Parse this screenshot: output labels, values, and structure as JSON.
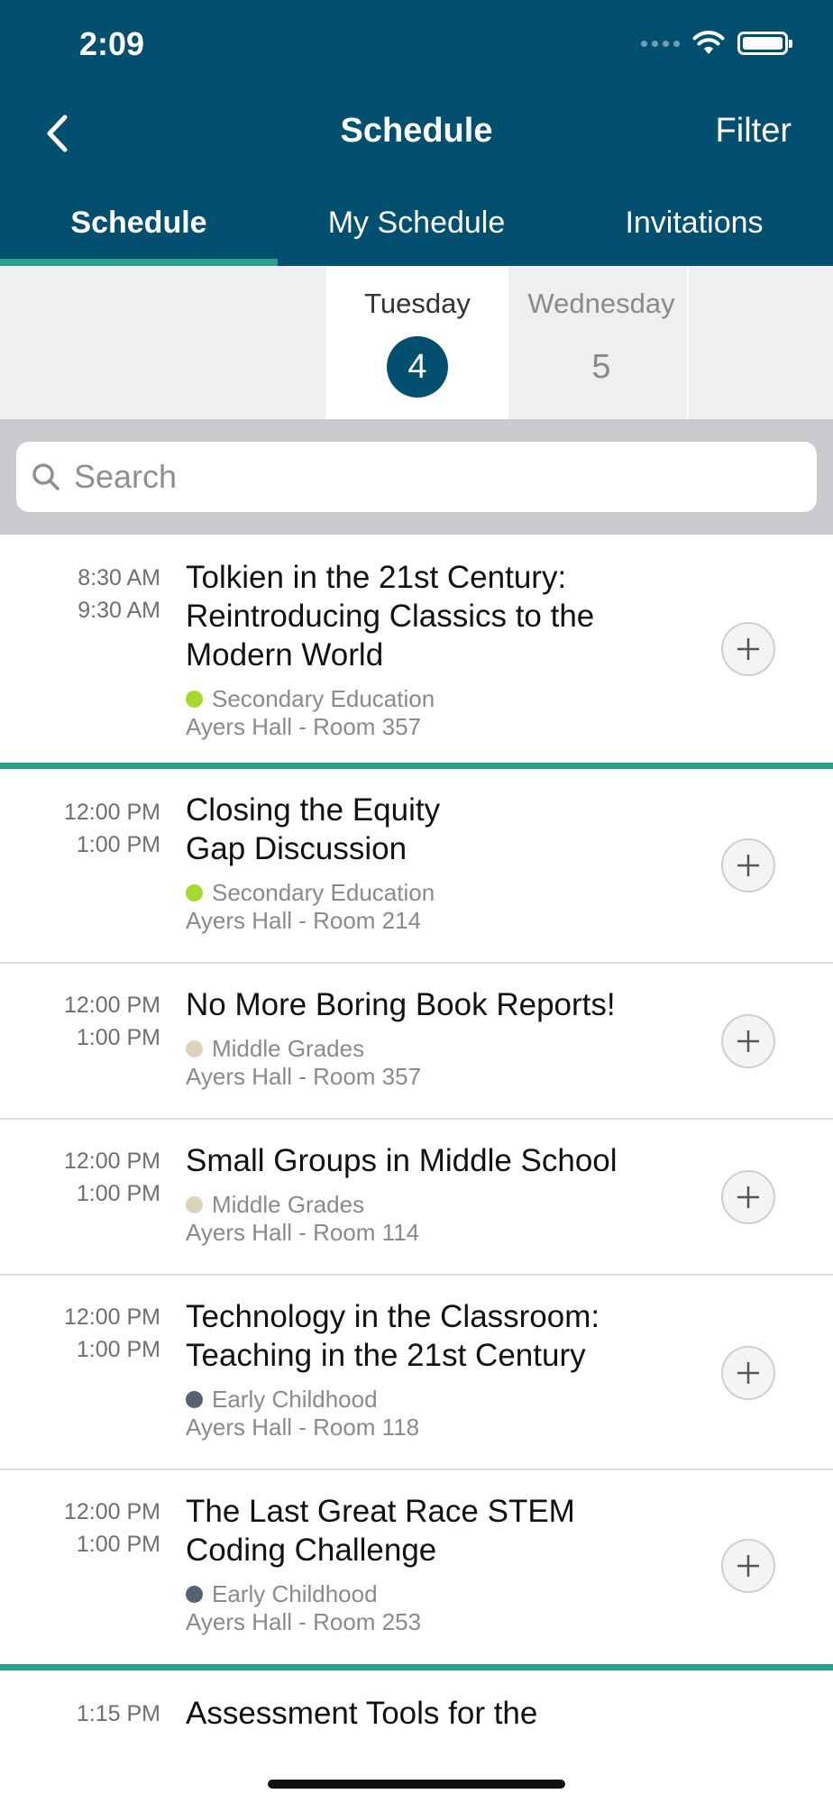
{
  "status_bar": {
    "time": "2:09"
  },
  "nav": {
    "title": "Schedule",
    "filter_label": "Filter"
  },
  "tabs": [
    {
      "label": "Schedule",
      "active": true
    },
    {
      "label": "My Schedule",
      "active": false
    },
    {
      "label": "Invitations",
      "active": false
    }
  ],
  "dates": [
    {
      "day": "Tuesday",
      "number": "4",
      "selected": true
    },
    {
      "day": "Wednesday",
      "number": "5",
      "selected": false
    }
  ],
  "search": {
    "placeholder": "Search"
  },
  "sessions": [
    {
      "start": "8:30 AM",
      "end": "9:30 AM",
      "title": "Tolkien in the 21st Century: Reintroducing Classics to the Modern World",
      "track": "Secondary Education",
      "track_color": "#a6d92f",
      "location": "Ayers Hall - Room 357"
    },
    {
      "start": "12:00 PM",
      "end": "1:00 PM",
      "title": "Closing the Equity Gap Discussion",
      "track": "Secondary Education",
      "track_color": "#a6d92f",
      "location": "Ayers Hall - Room 214"
    },
    {
      "start": "12:00 PM",
      "end": "1:00 PM",
      "title": "No More Boring Book Reports!",
      "track": "Middle Grades",
      "track_color": "#ddd3bd",
      "location": "Ayers Hall - Room 357"
    },
    {
      "start": "12:00 PM",
      "end": "1:00 PM",
      "title": "Small Groups in Middle School",
      "track": "Middle Grades",
      "track_color": "#ddd3bd",
      "location": "Ayers Hall - Room 114"
    },
    {
      "start": "12:00 PM",
      "end": "1:00 PM",
      "title": "Technology in the Classroom: Teaching in the 21st Century",
      "track": "Early Childhood",
      "track_color": "#566172",
      "location": "Ayers Hall - Room 118"
    },
    {
      "start": "12:00 PM",
      "end": "1:00 PM",
      "title": "The Last Great Race STEM Coding Challenge",
      "track": "Early Childhood",
      "track_color": "#566172",
      "location": "Ayers Hall - Room 253"
    },
    {
      "start": "1:15 PM",
      "title": "Assessment Tools for the"
    }
  ],
  "colors": {
    "header": "#034f70",
    "accent": "#2a9f8a"
  }
}
